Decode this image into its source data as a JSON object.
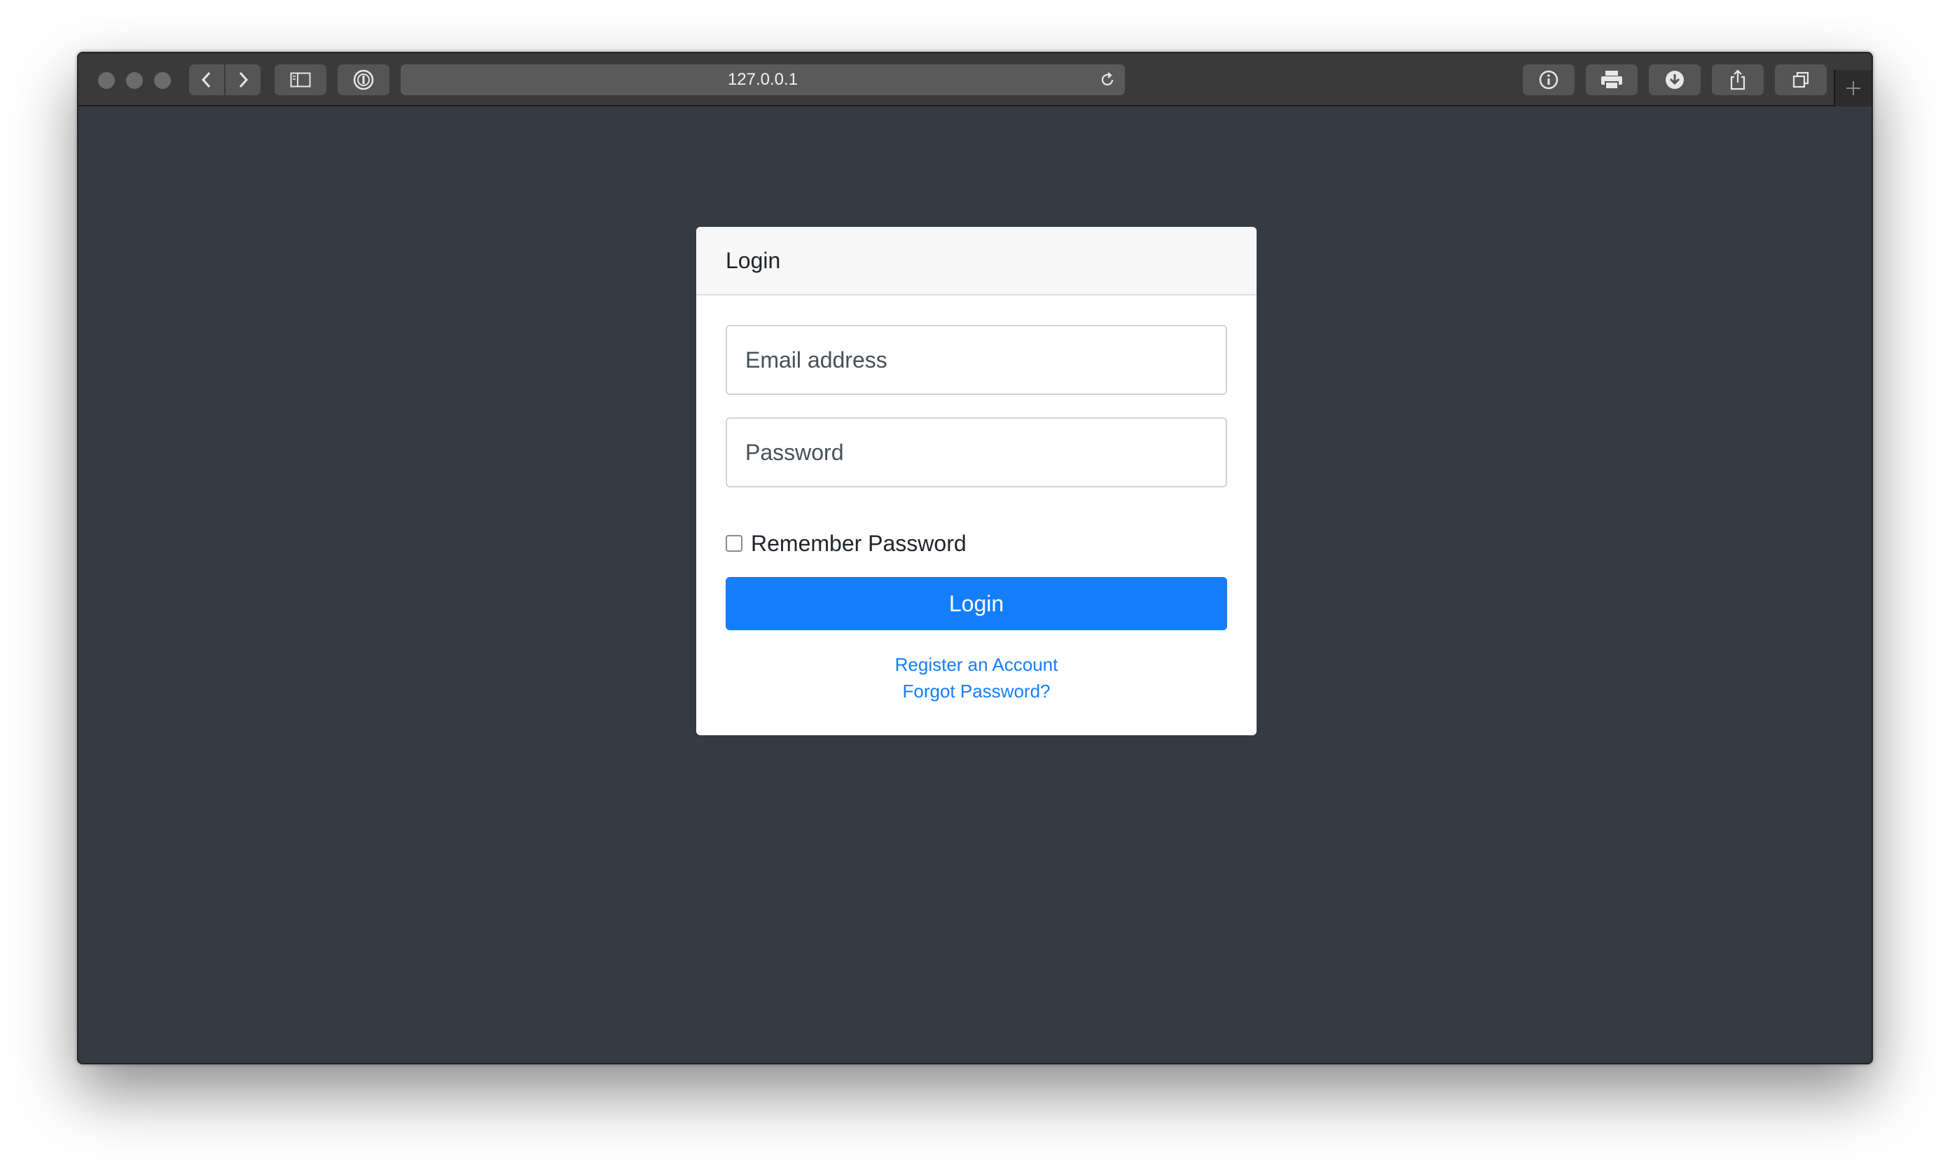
{
  "browser": {
    "url": "127.0.0.1",
    "icons": {
      "back": "chevron-left-icon",
      "forward": "chevron-right-icon",
      "sidebar": "sidebar-icon",
      "password_manager": "password-manager-icon",
      "reload": "reload-icon",
      "info": "info-icon",
      "print": "print-icon",
      "download": "download-icon",
      "share": "share-icon",
      "tabs": "tabs-icon",
      "new_tab": "plus-icon"
    }
  },
  "login_card": {
    "header": "Login",
    "email_placeholder": "Email address",
    "email_value": "",
    "password_placeholder": "Password",
    "password_value": "",
    "remember_label": "Remember Password",
    "remember_checked": false,
    "submit_label": "Login",
    "register_link": "Register an Account",
    "forgot_link": "Forgot Password?"
  },
  "colors": {
    "page_background": "#363a43",
    "primary": "#157efb",
    "card_header_bg": "#f7f7f7"
  }
}
